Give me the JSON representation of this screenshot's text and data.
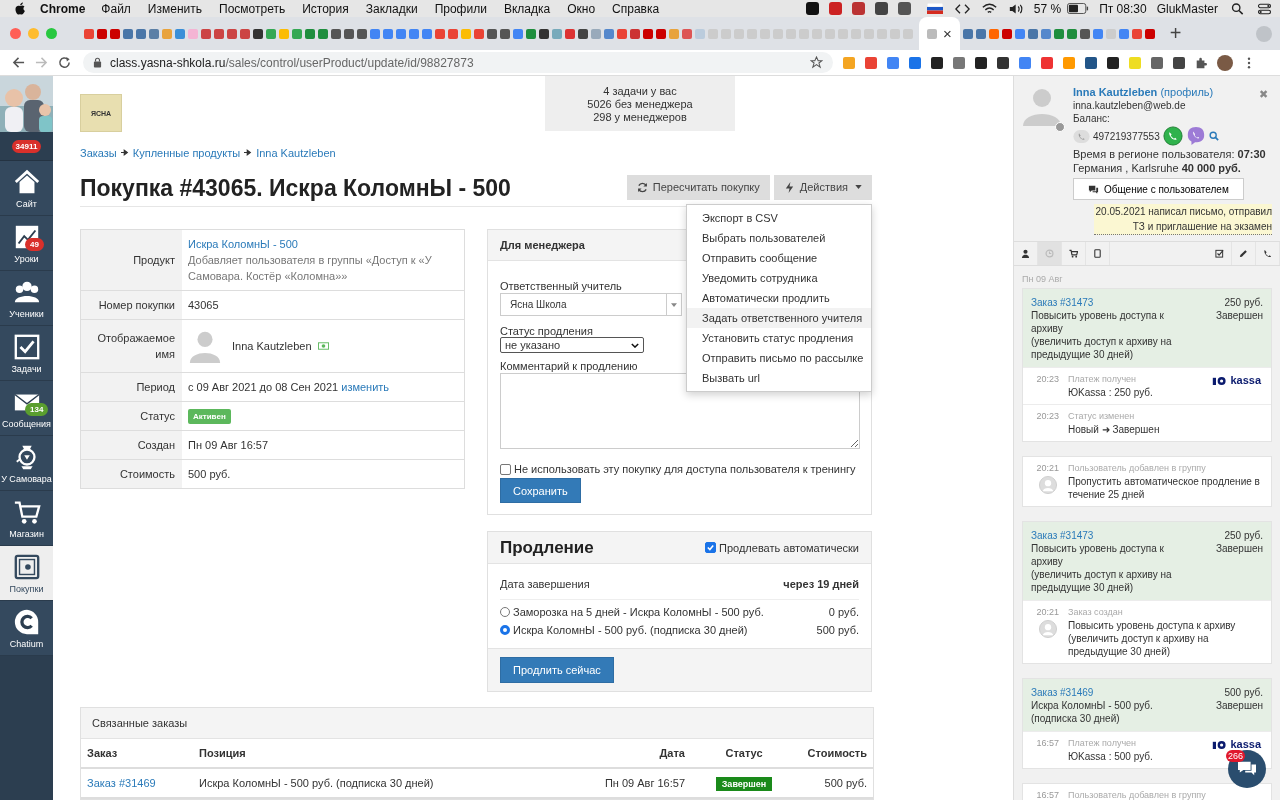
{
  "menubar": {
    "app": "Chrome",
    "menus": [
      "Файл",
      "Изменить",
      "Посмотреть",
      "История",
      "Закладки",
      "Профили",
      "Вкладка",
      "Окно",
      "Справка"
    ],
    "battery": "57 %",
    "clock": "Пт 08:30",
    "user": "GlukMaster"
  },
  "browser": {
    "close_tab": "×",
    "new_tab": "+",
    "url_host": "class.yasna-shkola.ru",
    "url_path": "/sales/control/userProduct/update/id/98827873"
  },
  "sidebar": {
    "badge": "34911",
    "items": [
      {
        "label": "Сайт",
        "kind": "home",
        "selected": false
      },
      {
        "label": "Уроки",
        "kind": "chart",
        "selected": false,
        "badge": {
          "text": "49",
          "color": "#d9302b"
        }
      },
      {
        "label": "Ученики",
        "kind": "users",
        "selected": false
      },
      {
        "label": "Задачи",
        "kind": "tasks",
        "selected": false
      },
      {
        "label": "Сообщения",
        "kind": "mail",
        "selected": false,
        "badge": {
          "text": "134",
          "color": "#5a9e2f"
        }
      },
      {
        "label": "У Самовара",
        "kind": "samovar",
        "selected": false
      },
      {
        "label": "Магазин",
        "kind": "cart",
        "selected": false
      },
      {
        "label": "Покупки",
        "kind": "safe",
        "selected": true
      },
      {
        "label": "Chatium",
        "kind": "chatium",
        "selected": false
      }
    ]
  },
  "logo": {
    "text": "ЯСНА"
  },
  "stats": [
    "4 задачи у вас",
    "5026 без менеджера",
    "298 у менеджеров"
  ],
  "breadcrumbs": [
    "Заказы",
    "Купленные продукты",
    "Inna Kautzleben"
  ],
  "title": "Покупка #43065. Искра КоломнЫ - 500",
  "actions": {
    "recalc": "Пересчитать покупку",
    "menu": "Действия",
    "menu_open": true,
    "items": [
      {
        "label": "Экспорт в CSV",
        "selected": false
      },
      {
        "label": "Выбрать пользователей",
        "selected": false
      },
      {
        "label": "Отправить сообщение",
        "selected": false
      },
      {
        "label": "Уведомить сотрудника",
        "selected": false
      },
      {
        "label": "Автоматически продлить",
        "selected": false
      },
      {
        "label": "Задать ответственного учителя",
        "selected": true
      },
      {
        "label": "Установить статус продления",
        "selected": false
      },
      {
        "label": "Отправить письмо по рассылке",
        "selected": false
      },
      {
        "label": "Вызвать url",
        "selected": false
      }
    ]
  },
  "details": [
    {
      "label": "Продукт",
      "kind": "product",
      "link": "Искра КоломнЫ - 500",
      "note": "Добавляет пользователя в группы «Доступ к «У Самовара. Костёр «Коломна»»"
    },
    {
      "label": "Номер покупки",
      "kind": "text",
      "value": "43065"
    },
    {
      "label": "Отображаемое имя",
      "kind": "user",
      "value": "Inna Kautzleben"
    },
    {
      "label": "Период",
      "kind": "period",
      "value": "с 09 Авг 2021 до 08 Сен 2021",
      "link": "изменить"
    },
    {
      "label": "Статус",
      "kind": "badge",
      "value": "Активен"
    },
    {
      "label": "Создан",
      "kind": "text",
      "value": "Пн 09 Авг 16:57"
    },
    {
      "label": "Стоимость",
      "kind": "text",
      "value": "500 руб."
    }
  ],
  "manager": {
    "title": "Для менеджера",
    "teacher_label": "Ответственный учитель",
    "teacher": "Ясна Школа",
    "renewal_label": "Статус продления",
    "renewal": "не указано",
    "comment_label": "Комментарий к продлению",
    "no_access_label": "Не использовать эту покупку для доступа пользователя к тренингу",
    "no_access_checked": false,
    "save": "Сохранить"
  },
  "renewal": {
    "title": "Продление",
    "auto_label": "Продлевать автоматически",
    "auto": true,
    "end_label": "Дата завершения",
    "end_value": "через 19 дней",
    "options": [
      {
        "label": "Заморозка на 5 дней - Искра КоломнЫ - 500 руб.",
        "price": "0 руб.",
        "selected": false
      },
      {
        "label": "Искра КоломнЫ - 500 руб. (подписка 30 дней)",
        "price": "500 руб.",
        "selected": true
      }
    ],
    "button": "Продлить сейчас"
  },
  "related": {
    "title": "Связанные заказы",
    "columns": [
      "Заказ",
      "Позиция",
      "Дата",
      "Статус",
      "Стоимость"
    ],
    "rows": [
      {
        "order": "Заказ #31469",
        "item": "Искра КоломнЫ - 500 руб. (подписка 30 дней)",
        "date": "Пн 09 Авг 16:57",
        "status": "Завершен",
        "price": "500 руб."
      }
    ]
  },
  "user_panel": {
    "name": "Inna Kautzleben",
    "profile": "(профиль)",
    "close": "✖",
    "email": "inna.kautzleben@web.de",
    "balance": "Баланс:",
    "phone": "497219377553",
    "time": "Время в регионе пользователя: **07:30**",
    "location": "Германия , Karlsruhe **40 000 руб.**",
    "chat_button": "Общение с пользователем",
    "note": "20.05.2021 написал письмо, отправил ТЗ и приглашение на экзамен",
    "tabs": [
      {
        "kind": "user",
        "selected": false
      },
      {
        "kind": "history",
        "selected": true
      },
      {
        "kind": "cart",
        "selected": false
      },
      {
        "kind": "tablet",
        "selected": false
      },
      {
        "kind": "tasks",
        "selected": false
      },
      {
        "kind": "pencil",
        "selected": false
      },
      {
        "kind": "phone",
        "selected": false
      }
    ],
    "date": "Пн 09 Авг",
    "feed": [
      {
        "order": {
          "link": "Заказ #31473",
          "lines": [
            "Повысить уровень доступа к архиву",
            "(увеличить доступ к архиву на предыдущие 30 дней)"
          ],
          "amount": "250 руб.",
          "status": "Завершен"
        },
        "events": [
          {
            "kind": "payment",
            "time": "20:23",
            "title": "Платеж получен",
            "text": "ЮKassa : 250 руб.",
            "logo": "kassa"
          },
          {
            "kind": "status",
            "time": "20:23",
            "title": "Статус изменен",
            "text": "Новый ➜ Завершен"
          }
        ]
      },
      {
        "events": [
          {
            "kind": "user",
            "time": "20:21",
            "title": "Пользователь добавлен в группу",
            "text": "Пропустить автоматическое продление в течение 25 дней"
          }
        ]
      },
      {
        "order": {
          "link": "Заказ #31473",
          "lines": [
            "Повысить уровень доступа к архиву",
            "(увеличить доступ к архиву на предыдущие 30 дней)"
          ],
          "amount": "250 руб.",
          "status": "Завершен"
        },
        "events": [
          {
            "kind": "user",
            "time": "20:21",
            "title": "Заказ создан",
            "text": "Повысить уровень доступа к архиву (увеличить доступ к архиву на предыдущие 30 дней)"
          }
        ]
      },
      {
        "order": {
          "link": "Заказ #31469",
          "lines": [
            "Искра КоломнЫ - 500 руб.",
            "(подписка 30 дней)"
          ],
          "amount": "500 руб.",
          "status": "Завершен"
        },
        "events": [
          {
            "kind": "payment",
            "time": "16:57",
            "title": "Платеж получен",
            "text": "ЮKassa : 500 руб.",
            "logo": "kassa"
          }
        ]
      },
      {
        "events": [
          {
            "kind": "plain",
            "time": "16:57",
            "title": "Пользователь добавлен в группу"
          }
        ]
      }
    ],
    "chat_badge": "266"
  }
}
